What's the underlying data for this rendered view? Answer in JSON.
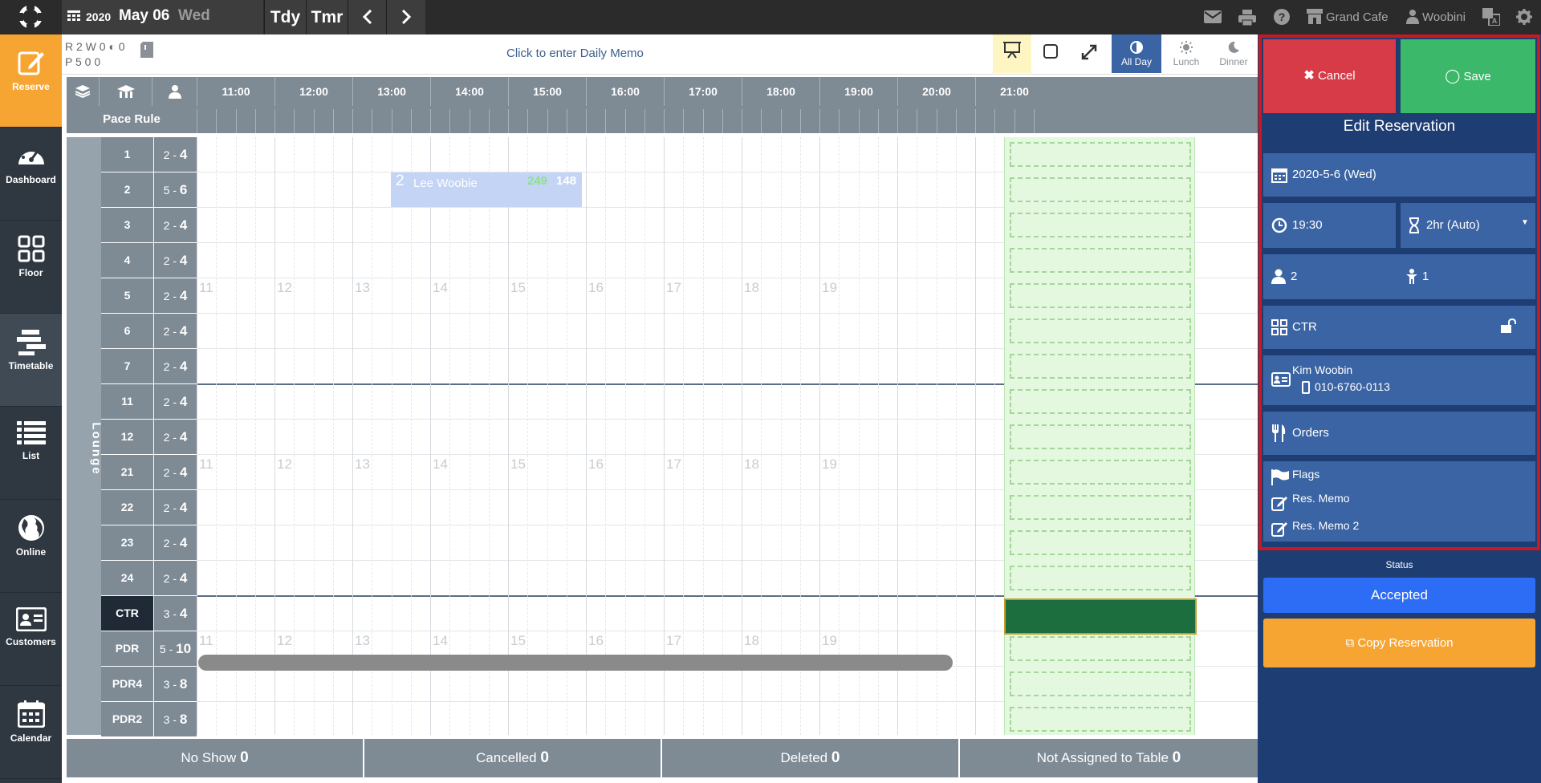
{
  "header": {
    "year": "2020",
    "date": "May 06",
    "weekday": "Wed",
    "today_label": "Tdy",
    "tomorrow_label": "Tmr",
    "venue": "Grand Cafe",
    "user": "Woobini"
  },
  "sidebar": {
    "items": [
      {
        "label": "Reserve",
        "icon": "edit-icon",
        "active": true
      },
      {
        "label": "Dashboard",
        "icon": "gauge-icon"
      },
      {
        "label": "Floor",
        "icon": "grid-icon"
      },
      {
        "label": "Timetable",
        "icon": "timetable-icon"
      },
      {
        "label": "List",
        "icon": "list-icon"
      },
      {
        "label": "Online",
        "icon": "globe-icon"
      },
      {
        "label": "Customers",
        "icon": "id-card-icon"
      },
      {
        "label": "Calendar",
        "icon": "calendar-icon"
      }
    ]
  },
  "counts": {
    "line1": "R 2 W 0 ◐ 0",
    "line2": "P 5    0    0"
  },
  "memo_text": "Click to enter Daily Memo",
  "view": {
    "all_day": "All Day",
    "lunch": "Lunch",
    "dinner": "Dinner"
  },
  "timetable": {
    "hours": [
      "11:00",
      "12:00",
      "13:00",
      "14:00",
      "15:00",
      "16:00",
      "17:00",
      "18:00",
      "19:00",
      "20:00",
      "21:00"
    ],
    "pace_rule_label": "Pace Rule",
    "area": "Lounge",
    "ghost_hours": [
      "11",
      "12",
      "13",
      "14",
      "15",
      "16",
      "17",
      "18",
      "19"
    ],
    "tables": [
      {
        "name": "1",
        "min": "2",
        "max": "4"
      },
      {
        "name": "2",
        "min": "5",
        "max": "6"
      },
      {
        "name": "3",
        "min": "2",
        "max": "4"
      },
      {
        "name": "4",
        "min": "2",
        "max": "4"
      },
      {
        "name": "5",
        "min": "2",
        "max": "4"
      },
      {
        "name": "6",
        "min": "2",
        "max": "4"
      },
      {
        "name": "7",
        "min": "2",
        "max": "4"
      },
      {
        "name": "11",
        "min": "2",
        "max": "4"
      },
      {
        "name": "12",
        "min": "2",
        "max": "4"
      },
      {
        "name": "21",
        "min": "2",
        "max": "4"
      },
      {
        "name": "22",
        "min": "2",
        "max": "4"
      },
      {
        "name": "23",
        "min": "2",
        "max": "4"
      },
      {
        "name": "24",
        "min": "2",
        "max": "4"
      },
      {
        "name": "CTR",
        "min": "3",
        "max": "4"
      },
      {
        "name": "PDR",
        "min": "5",
        "max": "10"
      },
      {
        "name": "PDR4",
        "min": "3",
        "max": "8"
      },
      {
        "name": "PDR2",
        "min": "3",
        "max": "8"
      }
    ],
    "booking": {
      "party": "2",
      "name": "Lee Woobie",
      "code1": "249",
      "code2": "148"
    }
  },
  "bottom": [
    {
      "label": "No Show",
      "count": "0"
    },
    {
      "label": "Cancelled",
      "count": "0"
    },
    {
      "label": "Deleted",
      "count": "0"
    },
    {
      "label": "Not Assigned to Table",
      "count": "0"
    }
  ],
  "panel": {
    "cancel_label": "Cancel",
    "save_label": "Save",
    "title": "Edit Reservation",
    "date": "2020-5-6 (Wed)",
    "time": "19:30",
    "duration": "2hr (Auto)",
    "adults": "2",
    "kids": "1",
    "table": "CTR",
    "customer_name": "Kim Woobin",
    "customer_phone": "010-6760-0113",
    "orders_label": "Orders",
    "flags_label": "Flags",
    "memo1_label": "Res. Memo",
    "memo2_label": "Res. Memo 2",
    "status_label": "Status",
    "status_value": "Accepted",
    "copy_label": "Copy Reservation"
  }
}
